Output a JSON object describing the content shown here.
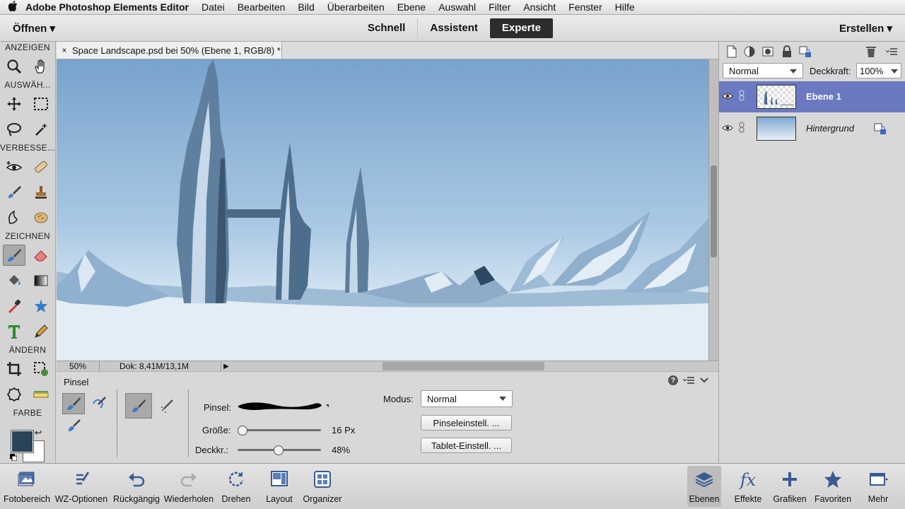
{
  "menubar": {
    "apple": "",
    "app": "Adobe Photoshop Elements Editor",
    "items": [
      "Datei",
      "Bearbeiten",
      "Bild",
      "Überarbeiten",
      "Ebene",
      "Auswahl",
      "Filter",
      "Ansicht",
      "Fenster",
      "Hilfe"
    ]
  },
  "modebar": {
    "open": "Öffnen ▾",
    "modes": [
      "Schnell",
      "Assistent",
      "Experte"
    ],
    "active_mode": "Experte",
    "create": "Erstellen ▾"
  },
  "toolbox": {
    "sections": [
      "ANZEIGEN",
      "AUSWÄH...",
      "VERBESSE...",
      "ZEICHNEN",
      "ÄNDERN",
      "FARBE"
    ],
    "fg_color": "#2a4356",
    "bg_color": "#ffffff"
  },
  "document": {
    "tab_close": "×",
    "tab_title": "Space Landscape.psd bei 50% (Ebene 1, RGB/8) *",
    "zoom": "50%",
    "doc_info": "Dok: 8,41M/13,1M",
    "sky_color": "#7fa8cf"
  },
  "options": {
    "title": "Pinsel",
    "brush_label": "Pinsel:",
    "size_label": "Größe:",
    "size_value": "16 Px",
    "size_fraction": 0.05,
    "opacity_label": "Deckkr.:",
    "opacity_value": "48%",
    "opacity_fraction": 0.48,
    "mode_label": "Modus:",
    "mode_value": "Normal",
    "brush_settings": "Pinseleinstell. ...",
    "tablet_settings": "Tablet-Einstell. ..."
  },
  "layers": {
    "blend_mode": "Normal",
    "opacity_label": "Deckkraft:",
    "opacity_value": "100%",
    "items": [
      {
        "name": "Ebene 1",
        "selected": true
      },
      {
        "name": "Hintergrund",
        "selected": false
      }
    ],
    "selected_color": "#6a79c0"
  },
  "bottombar": {
    "left": [
      "Fotobereich",
      "WZ-Optionen",
      "Rückgängig",
      "Wiederholen",
      "Drehen",
      "Layout",
      "Organizer"
    ],
    "right": [
      "Ebenen",
      "Effekte",
      "Grafiken",
      "Favoriten",
      "Mehr"
    ],
    "right_icon_text": [
      "",
      "fx",
      "",
      "",
      ""
    ]
  }
}
